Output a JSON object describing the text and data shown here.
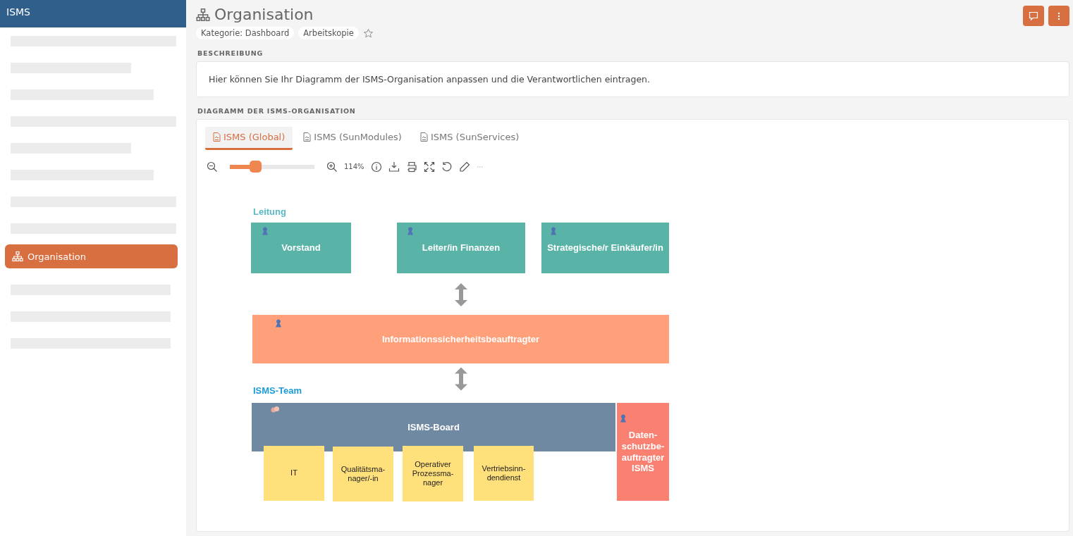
{
  "app": {
    "title": "ISMS"
  },
  "sidebar": {
    "items": [
      {
        "kind": "placeholder"
      },
      {
        "kind": "placeholder"
      },
      {
        "kind": "placeholder"
      },
      {
        "kind": "placeholder"
      },
      {
        "kind": "placeholder"
      },
      {
        "kind": "placeholder"
      },
      {
        "kind": "placeholder"
      },
      {
        "kind": "placeholder"
      },
      {
        "kind": "link",
        "label": "Organisation",
        "selected": true
      },
      {
        "kind": "placeholder"
      },
      {
        "kind": "placeholder"
      },
      {
        "kind": "placeholder"
      }
    ]
  },
  "page": {
    "title": "Organisation",
    "tags": [
      "Kategorie: Dashboard",
      "Arbeitskopie"
    ],
    "favorite": false
  },
  "description": {
    "heading": "BESCHREIBUNG",
    "text": "Hier können Sie Ihr Diagramm der ISMS-Organisation anpassen und die Verantwortlichen eintragen."
  },
  "diagram": {
    "heading": "DIAGRAMM DER ISMS-ORGANISATION",
    "tabs": [
      {
        "label": "ISMS (Global)",
        "selected": true
      },
      {
        "label": "ISMS (SunModules)",
        "selected": false
      },
      {
        "label": "ISMS (SunServices)",
        "selected": false
      }
    ],
    "zoom": {
      "level": 0.3,
      "reading": "114%"
    },
    "groups": [
      {
        "title": "Leitung",
        "color": "#5bb8c4"
      },
      {
        "title": "ISMS-Team",
        "color": "#1e9bd7"
      }
    ],
    "nodes": [
      {
        "label": "Vorstand",
        "kind": "person",
        "color": "#59b3a6"
      },
      {
        "label": "Leiter/in Finanzen",
        "kind": "person",
        "color": "#59b3a6"
      },
      {
        "label": "Strategische/r Einkäufer/in",
        "kind": "person",
        "color": "#59b3a6"
      },
      {
        "label": "Informationssicherheitsbeauftragter",
        "kind": "person",
        "color": "#ffa07a"
      },
      {
        "label": "ISMS-Board",
        "kind": "team",
        "color": "#7089a3"
      },
      {
        "label": "Daten-\nschutzbe-\nauftragter\nISMS",
        "kind": "person",
        "color": "#fa8072"
      },
      {
        "label": "IT",
        "kind": "note",
        "color": "#ffe07a"
      },
      {
        "label": "Qualitätsma-\nnager/-in",
        "kind": "note",
        "color": "#ffe07a"
      },
      {
        "label": "Operativer\nProzessma-\nnager",
        "kind": "note",
        "color": "#ffe07a"
      },
      {
        "label": "Vertriebsinn-\ndendienst",
        "kind": "note",
        "color": "#ffe07a"
      }
    ]
  }
}
